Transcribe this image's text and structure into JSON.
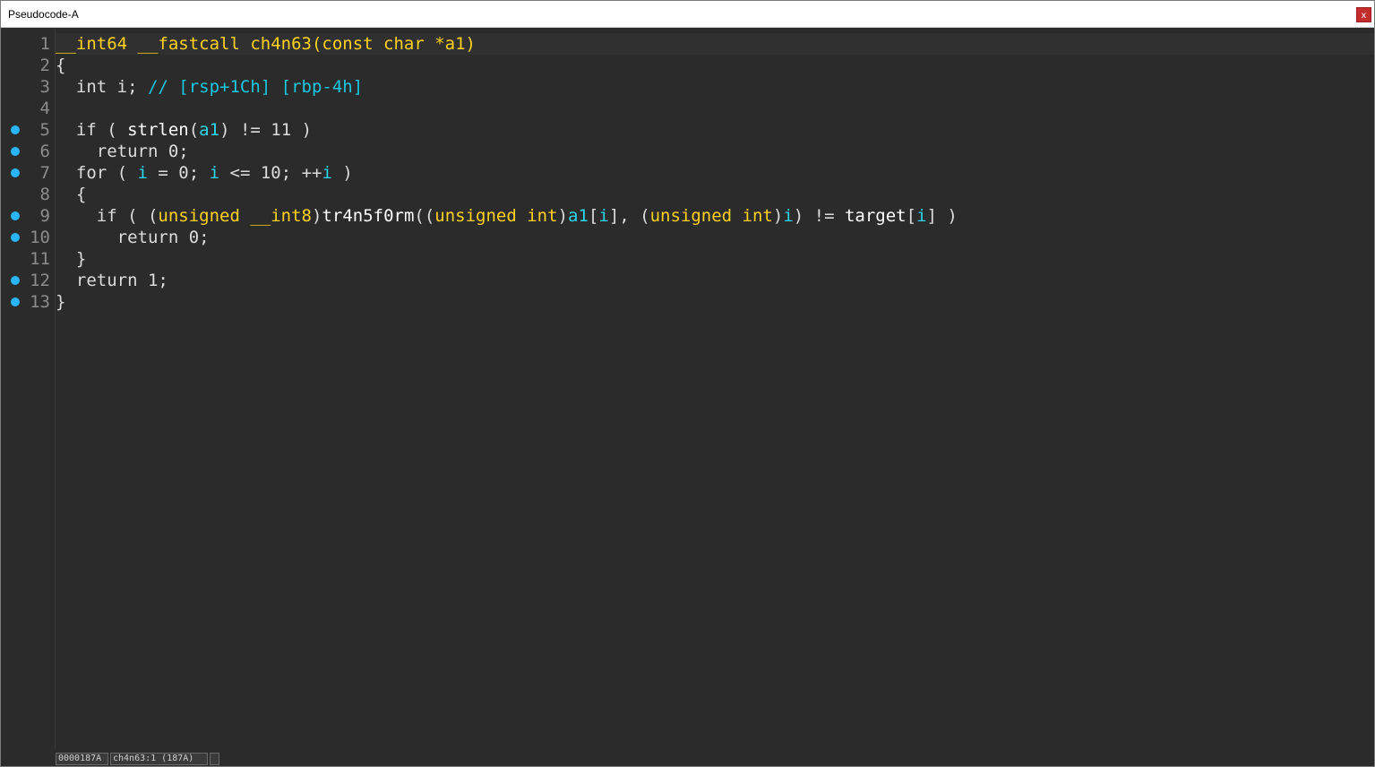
{
  "window": {
    "title": "Pseudocode-A",
    "close_label": "x"
  },
  "code": {
    "lines": [
      {
        "num": "1",
        "tokens": [
          {
            "c": "kw",
            "t": "__int64 __fastcall ch4n63(const char *a1)"
          }
        ]
      },
      {
        "num": "2",
        "tokens": [
          {
            "c": "plain",
            "t": "{"
          }
        ]
      },
      {
        "num": "3",
        "tokens": [
          {
            "c": "plain",
            "t": "  int i; "
          },
          {
            "c": "cmt",
            "t": "// [rsp+1Ch] [rbp-4h]"
          }
        ]
      },
      {
        "num": "4",
        "tokens": []
      },
      {
        "num": "5",
        "breakpoint": true,
        "tokens": [
          {
            "c": "plain",
            "t": "  if ( "
          },
          {
            "c": "fn",
            "t": "strlen"
          },
          {
            "c": "plain",
            "t": "("
          },
          {
            "c": "var",
            "t": "a1"
          },
          {
            "c": "plain",
            "t": ") != 11 )"
          }
        ]
      },
      {
        "num": "6",
        "breakpoint": true,
        "tokens": [
          {
            "c": "plain",
            "t": "    return 0;"
          }
        ]
      },
      {
        "num": "7",
        "breakpoint": true,
        "tokens": [
          {
            "c": "plain",
            "t": "  for ( "
          },
          {
            "c": "var",
            "t": "i"
          },
          {
            "c": "plain",
            "t": " = 0; "
          },
          {
            "c": "var",
            "t": "i"
          },
          {
            "c": "plain",
            "t": " <= 10; ++"
          },
          {
            "c": "var",
            "t": "i"
          },
          {
            "c": "plain",
            "t": " )"
          }
        ]
      },
      {
        "num": "8",
        "tokens": [
          {
            "c": "plain",
            "t": "  {"
          }
        ]
      },
      {
        "num": "9",
        "breakpoint": true,
        "tokens": [
          {
            "c": "plain",
            "t": "    if ( ("
          },
          {
            "c": "kw",
            "t": "unsigned __int8"
          },
          {
            "c": "plain",
            "t": ")"
          },
          {
            "c": "fn",
            "t": "tr4n5f0rm"
          },
          {
            "c": "plain",
            "t": "(("
          },
          {
            "c": "kw",
            "t": "unsigned int"
          },
          {
            "c": "plain",
            "t": ")"
          },
          {
            "c": "var",
            "t": "a1"
          },
          {
            "c": "plain",
            "t": "["
          },
          {
            "c": "var",
            "t": "i"
          },
          {
            "c": "plain",
            "t": "], ("
          },
          {
            "c": "kw",
            "t": "unsigned int"
          },
          {
            "c": "plain",
            "t": ")"
          },
          {
            "c": "var",
            "t": "i"
          },
          {
            "c": "plain",
            "t": ") != "
          },
          {
            "c": "fn",
            "t": "target"
          },
          {
            "c": "plain",
            "t": "["
          },
          {
            "c": "var",
            "t": "i"
          },
          {
            "c": "plain",
            "t": "] )"
          }
        ]
      },
      {
        "num": "10",
        "breakpoint": true,
        "tokens": [
          {
            "c": "plain",
            "t": "      return 0;"
          }
        ]
      },
      {
        "num": "11",
        "tokens": [
          {
            "c": "plain",
            "t": "  }"
          }
        ]
      },
      {
        "num": "12",
        "breakpoint": true,
        "tokens": [
          {
            "c": "plain",
            "t": "  return 1;"
          }
        ]
      },
      {
        "num": "13",
        "breakpoint": true,
        "tokens": [
          {
            "c": "plain",
            "t": "}"
          }
        ]
      }
    ]
  },
  "status": {
    "address": "0000187A",
    "location": "ch4n63:1 (187A)",
    "extra": ""
  },
  "colors": {
    "background": "#2b2b2b",
    "keyword": "#ffd21f",
    "variable": "#2ad6e8",
    "comment": "#19c7e0",
    "plain": "#dcdcdc",
    "line_number": "#8c8c8c",
    "breakpoint": "#29b6f6"
  }
}
